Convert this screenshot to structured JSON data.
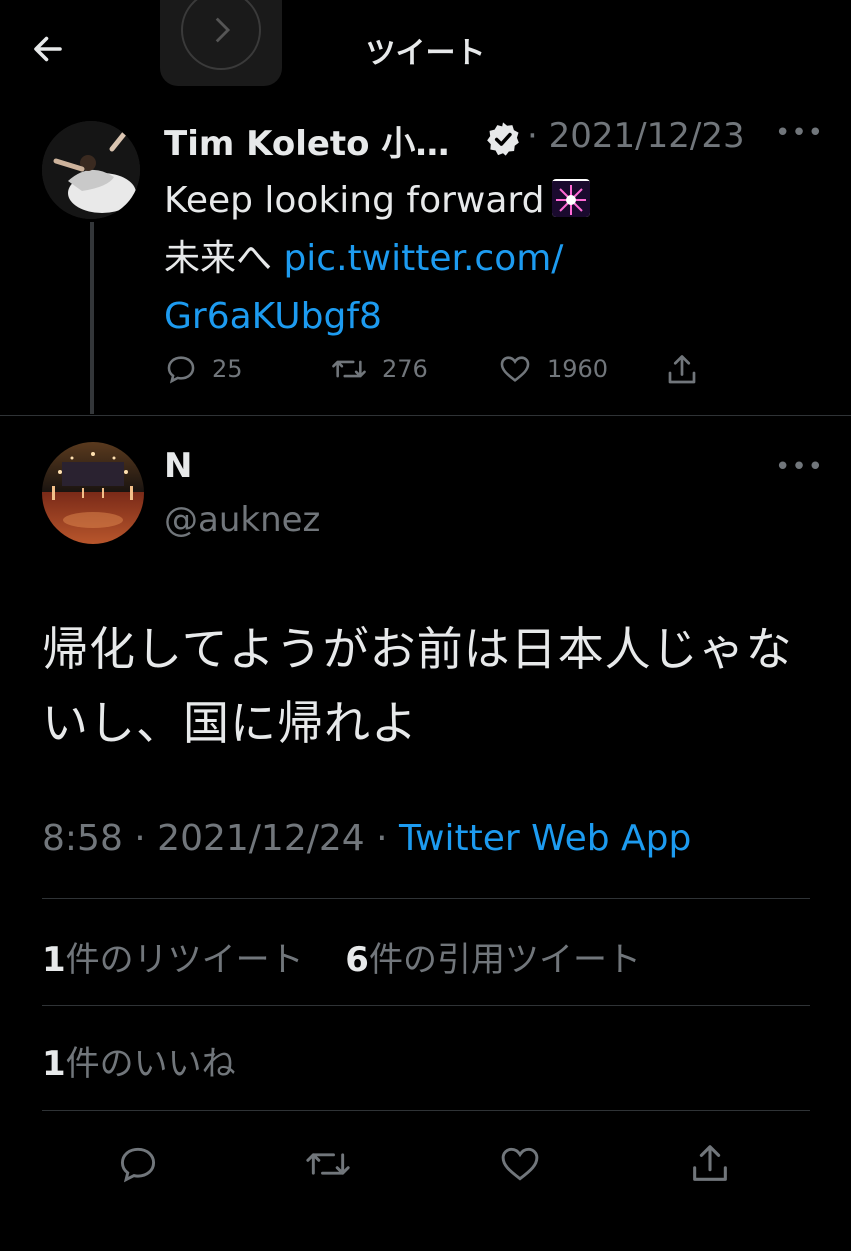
{
  "header": {
    "title": "ツイート"
  },
  "parent_tweet": {
    "author_name": "Tim Koleto 小…",
    "date": "· 2021/12/23",
    "text_line1": "Keep looking forward",
    "text_line2_prefix": "未来へ ",
    "link_line1": "pic.twitter.com/",
    "link_line2": "Gr6aKUbgf8",
    "replies": "25",
    "retweets": "276",
    "likes": "1960"
  },
  "main_tweet": {
    "author_name": "N",
    "handle": "@auknez",
    "text": "帰化してようがお前は日本人じゃないし、国に帰れよ",
    "time": "8:58 · 2021/12/24 · ",
    "source": "Twitter Web App",
    "retweet_count": "1",
    "retweet_label": "件のリツイート",
    "quote_count": "6",
    "quote_label": "件の引用ツイート",
    "like_count": "1",
    "like_label": "件のいいね"
  },
  "icons": {
    "back": "arrow-left-icon",
    "more": "more-dots-icon",
    "verified": "verified-badge-icon",
    "reply": "reply-icon",
    "retweet": "retweet-icon",
    "like": "heart-icon",
    "share": "share-icon"
  },
  "colors": {
    "background": "#000000",
    "text": "#e7e9ea",
    "muted": "#71767b",
    "link": "#1d9bf0",
    "divider": "#2f3336"
  }
}
